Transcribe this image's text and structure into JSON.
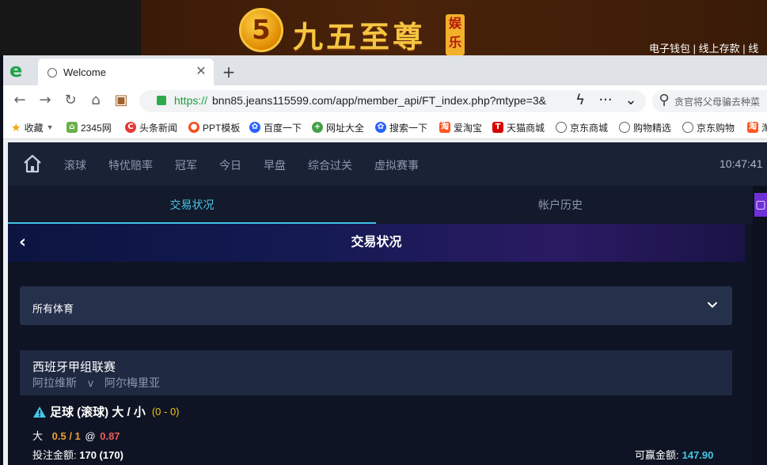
{
  "banner": {
    "logo_digit": "5",
    "brand_name": "九五至尊",
    "brand_tag": "娱乐",
    "links": "电子钱包 | 线上存款 | 线"
  },
  "browser": {
    "tab_title": "Welcome",
    "url_scheme": "https://",
    "url_rest": "bnn85.jeans115599.com/app/member_api/FT_index.php?mtype=3&",
    "search_placeholder": "贪官将父母骗去种菜",
    "bookmarks": [
      "收藏",
      "2345网",
      "头条新闻",
      "PPT模板",
      "百度一下",
      "网址大全",
      "搜索一下",
      "爱淘宝",
      "天猫商城",
      "京东商城",
      "购物精选",
      "京东购物",
      "淘"
    ]
  },
  "nav": {
    "items": [
      "滚球",
      "特优赔率",
      "冠军",
      "今日",
      "早盘",
      "综合过关",
      "虚拟赛事"
    ],
    "clock": "10:47:41"
  },
  "subtabs": {
    "status": "交易状况",
    "history": "帐户历史"
  },
  "header": {
    "title": "交易状况"
  },
  "filter": {
    "sport": "所有体育"
  },
  "match": {
    "league": "西班牙甲组联赛",
    "home": "阿拉维斯",
    "vs": "v",
    "away": "阿尔梅里亚"
  },
  "bet": {
    "type": "足球 (滚球) 大 / 小",
    "score": "(0 - 0)",
    "selection": "大",
    "line": "0.5 / 1",
    "at": "@",
    "odds": "0.87",
    "stake_label": "投注金额:",
    "stake_value": "170 (170)",
    "win_label": "可赢金额:",
    "win_value": "147.90"
  },
  "colors": {
    "accent": "#46c6e4",
    "odds": "#ef5b5b",
    "line": "#f0a030",
    "score": "#f0c419",
    "brand_gold": "#f4c542"
  }
}
